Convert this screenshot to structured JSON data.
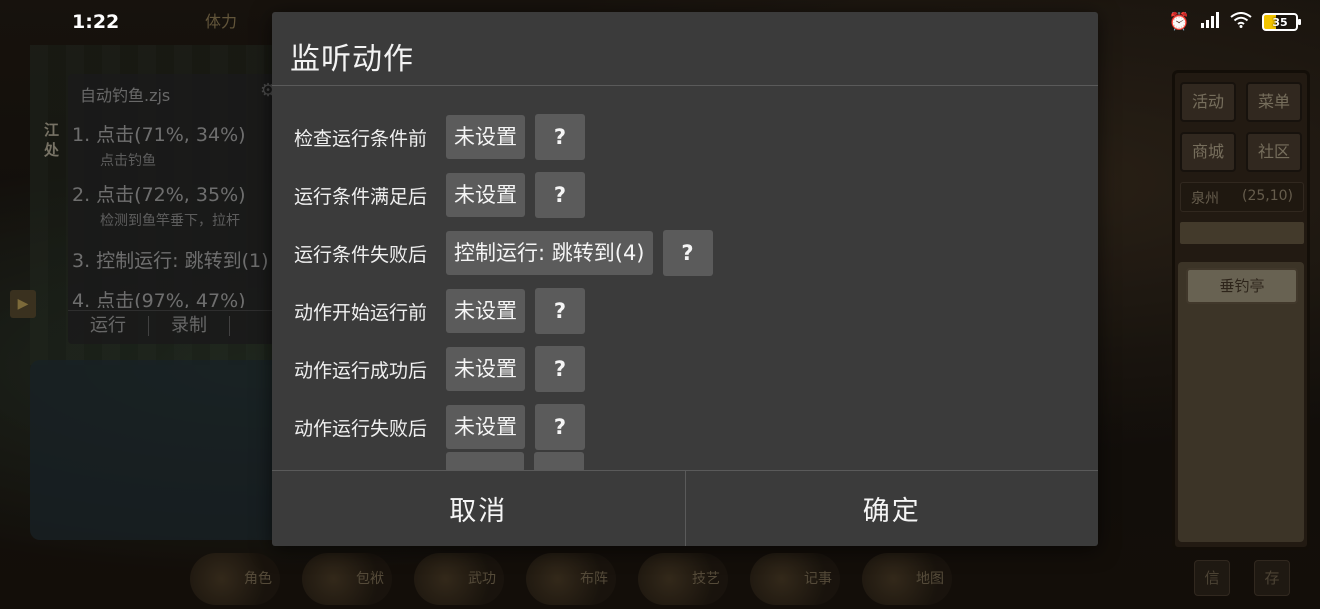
{
  "status_bar": {
    "time": "1:22",
    "battery_level": "35",
    "icons": [
      "alarm-icon",
      "signal-icon",
      "wifi-icon",
      "battery-icon"
    ]
  },
  "background_game": {
    "stamina_label": "体力",
    "buttons": [
      "活动",
      "菜单",
      "商城",
      "社区"
    ],
    "location_name": "泉州",
    "location_coords": "(25,10)",
    "place_name": "垂钓亭",
    "bottom_menu": [
      "角色",
      "包袱",
      "武功",
      "布阵",
      "技艺",
      "记事",
      "地图"
    ],
    "corner_buttons": [
      "信",
      "存"
    ],
    "side_text": [
      "江",
      "处"
    ]
  },
  "script_panel": {
    "filename": "自动钓鱼.zjs",
    "steps": [
      {
        "label": "1. 点击(71%, 34%)",
        "sub": "点击钓鱼"
      },
      {
        "label": "2. 点击(72%, 35%)",
        "sub": "检测到鱼竿垂下，拉杆"
      },
      {
        "label": "3. 控制运行: 跳转到(1)",
        "sub": ""
      },
      {
        "label": "4. 点击(97%, 47%)",
        "sub": ""
      }
    ],
    "tabs": [
      "运行",
      "录制"
    ]
  },
  "dialog": {
    "title": "监听动作",
    "hooks": [
      {
        "label": "检查运行条件前",
        "value": "未设置",
        "help": "?"
      },
      {
        "label": "运行条件满足后",
        "value": "未设置",
        "help": "?"
      },
      {
        "label": "运行条件失败后",
        "value": "控制运行: 跳转到(4)",
        "help": "?"
      },
      {
        "label": "动作开始运行前",
        "value": "未设置",
        "help": "?"
      },
      {
        "label": "动作运行成功后",
        "value": "未设置",
        "help": "?"
      },
      {
        "label": "动作运行失败后",
        "value": "未设置",
        "help": "?"
      }
    ],
    "cancel_label": "取消",
    "confirm_label": "确定"
  }
}
